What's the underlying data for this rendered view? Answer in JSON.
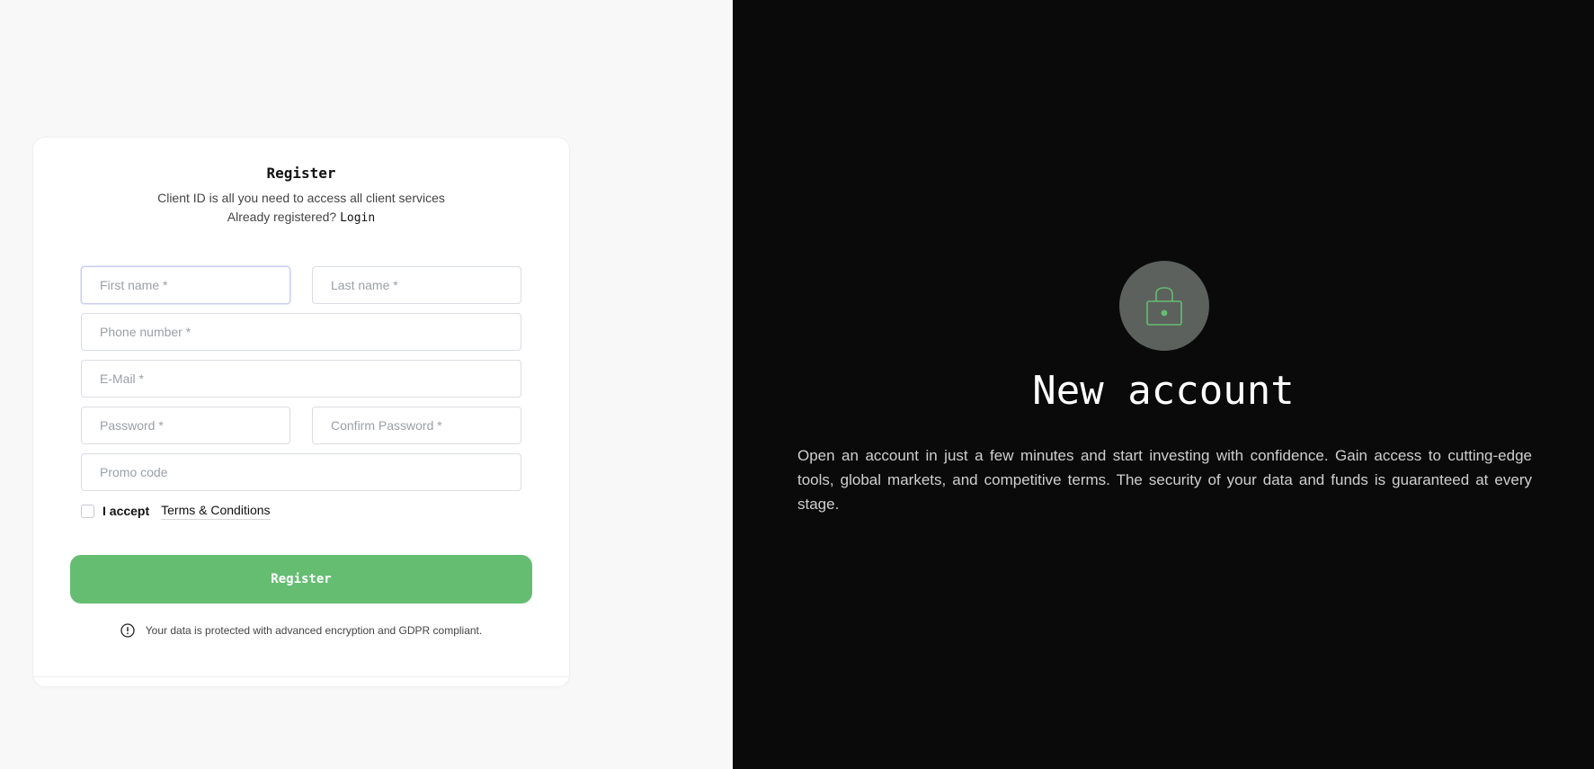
{
  "form": {
    "title": "Register",
    "subtitle": "Client ID is all you need to access all client services",
    "already_text": "Already registered?",
    "login_label": "Login",
    "fields": {
      "first_name": "First name *",
      "last_name": "Last name *",
      "phone": "Phone number *",
      "email": "E-Mail *",
      "password": "Password *",
      "confirm_password": "Confirm Password *",
      "promo": "Promo code"
    },
    "accept_label": "I accept",
    "terms_label": "Terms & Conditions",
    "register_button": "Register",
    "security_note": "Your data is protected with advanced encryption and GDPR compliant."
  },
  "promo": {
    "icon": "lock-icon",
    "heading": "New account",
    "description": "Open an account in just a few minutes and start investing with confidence. Gain access to cutting-edge tools, global markets, and competitive terms. The security of your data and funds is guaranteed at every stage."
  },
  "colors": {
    "accent": "#65bd72",
    "dark_panel": "#0a0a0a",
    "icon_circle": "#5c615d"
  }
}
